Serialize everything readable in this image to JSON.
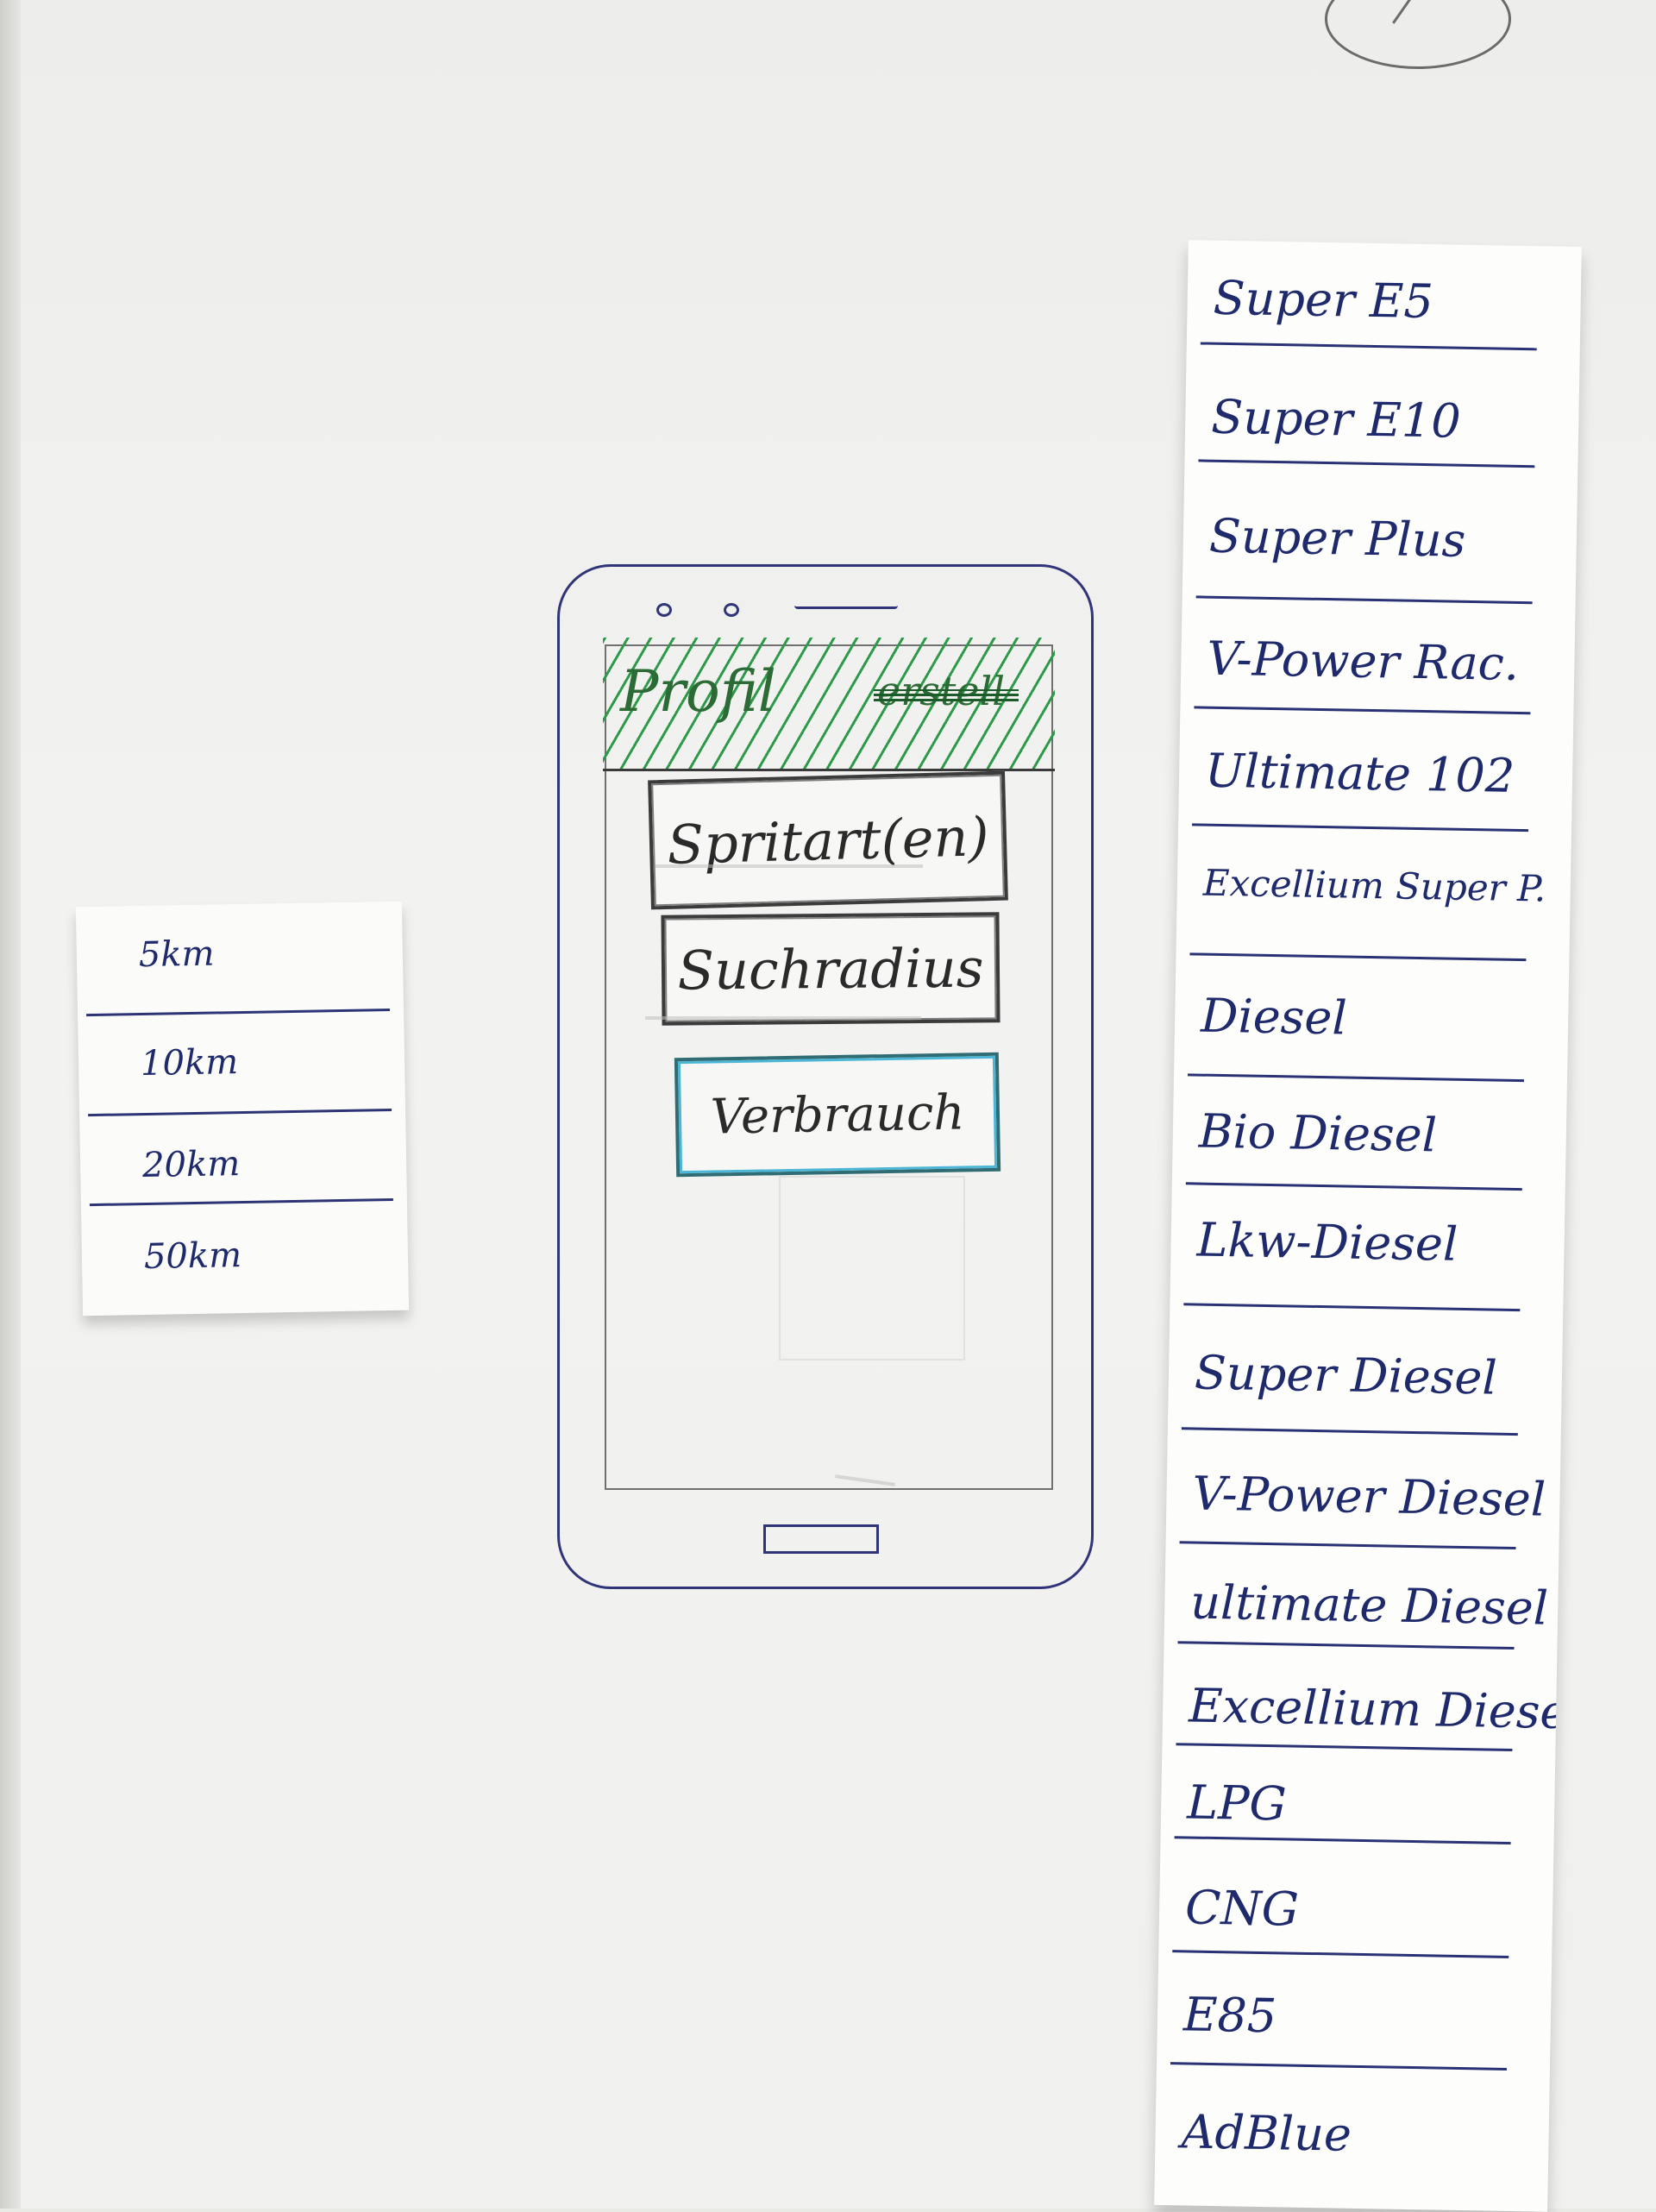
{
  "phone": {
    "header": {
      "title": "Profil",
      "crossed_text": "erstell"
    },
    "menu": [
      "Spritart(en)",
      "Suchradius",
      "Verbrauch"
    ]
  },
  "radius_options": [
    "5km",
    "10km",
    "20km",
    "50km"
  ],
  "fuel_types": [
    "Super E5",
    "Super E10",
    "Super Plus",
    "V-Power Rac.",
    "Ultimate 102",
    "Excellium Super P.",
    "Diesel",
    "Bio Diesel",
    "Lkw-Diesel",
    "Super Diesel",
    "V-Power Diesel",
    "ultimate Diesel",
    "Excellium Diesel",
    "LPG",
    "CNG",
    "E85",
    "AdBlue"
  ],
  "colors": {
    "ink": "#22306e",
    "hatch": "#2d9a4a",
    "accent": "#4cb6d6"
  }
}
